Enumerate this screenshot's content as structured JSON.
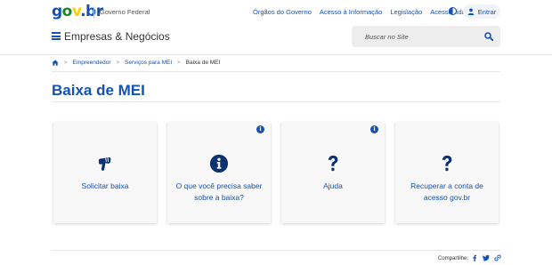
{
  "header": {
    "logo": {
      "g": "g",
      "o": "o",
      "v": "v",
      "dot": ".",
      "b": "b",
      "r": "r"
    },
    "gov_label": "Governo Federal",
    "top_links": [
      "Órgãos do Governo",
      "Acesso à Informação",
      "Legislação",
      "Acessibilidade"
    ],
    "login_label": "Entrar",
    "site_title": "Empresas & Negócios",
    "search": {
      "placeholder": "Buscar no Site"
    }
  },
  "breadcrumb": {
    "items": [
      "Empreendedor",
      "Serviços para MEI"
    ],
    "current": "Baixa de MEI"
  },
  "page": {
    "title": "Baixa de MEI"
  },
  "cards": [
    {
      "label": "Solicitar baixa",
      "icon": "hand-pointer-icon",
      "has_info": false
    },
    {
      "label": "O que você precisa saber sobre a baixa?",
      "icon": "info-circle-icon",
      "has_info": true
    },
    {
      "label": "Ajuda",
      "icon": "question-icon",
      "has_info": true
    },
    {
      "label": "Recuperar a conta de acesso gov.br",
      "icon": "question-icon",
      "has_info": false
    }
  ],
  "info_glyph": "i",
  "share": {
    "label": "Compartilhe:",
    "icons": [
      "facebook-icon",
      "twitter-icon",
      "link-icon"
    ]
  },
  "colors": {
    "primary": "#1351b4",
    "logo_green": "#168821",
    "logo_yellow": "#ffcd07"
  }
}
